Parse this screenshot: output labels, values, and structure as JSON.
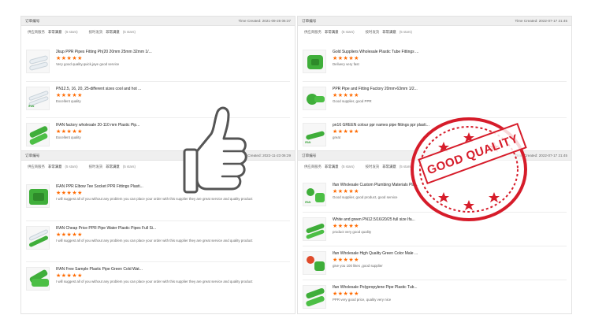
{
  "colors": {
    "star": "#ff6a00",
    "pipe_white": "#e9eef2",
    "pipe_green": "#3fae3a",
    "stamp": "#d61c2a"
  },
  "panels": [
    {
      "order_label": "订单编号",
      "time_created": "Time Created: 2021-09-28 06:37",
      "rating_label_1": "供应商服务",
      "rating_value_1": "非常满意",
      "rating_count_1": "(5 stars)",
      "rating_label_2": "按时发货",
      "rating_value_2": "非常满意",
      "rating_count_2": "(5 stars)",
      "items": [
        {
          "title": "2kup PPR Pipes Fitting Ph(20 20mm 25mm 32mm 1/...",
          "stars": "★★★★★",
          "comment": "Very good quality,quick,jaye good service",
          "thumb": "white-pipe"
        },
        {
          "title": "PN12.5, 16, 20, 25-different sizes cool and hot ...",
          "stars": "★★★★★",
          "comment": "Excellent quality",
          "thumb": "white-pipe"
        },
        {
          "title": "IFAN factory wholesale 20-110 mm Plastic Pip...",
          "stars": "★★★★★",
          "comment": "Excellent quality",
          "thumb": "green-pipe"
        }
      ]
    },
    {
      "order_label": "订单编号",
      "time_created": "Time Created: 2022-07-17 21:45",
      "rating_label_1": "供应商服务",
      "rating_value_1": "非常满意",
      "rating_count_1": "(5 stars)",
      "rating_label_2": "按时发货",
      "rating_value_2": "非常满意",
      "rating_count_2": "(5 stars)",
      "items": [
        {
          "title": "Gold Suppliers Wholesale Plastic Tube Fittings ...",
          "stars": "★★★★★",
          "comment": "Delivery very fast",
          "thumb": "green-fittings"
        },
        {
          "title": "PPR Pipe and Fitting Factory 20mm-63mm 1/2...",
          "stars": "★★★★★",
          "comment": "Good supplier, good PPR",
          "thumb": "green-fittings"
        },
        {
          "title": "pn16 GREEN colour ppr names pipe fittings ppr plasti...",
          "stars": "★★★★★",
          "comment": "great",
          "thumb": "green-pipe"
        }
      ]
    },
    {
      "order_label": "订单编号",
      "time_created": "Time Created: 2022-11-23 06:29",
      "rating_label_1": "供应商服务",
      "rating_value_1": "非常满意",
      "rating_count_1": "(5 stars)",
      "rating_label_2": "按时发货",
      "rating_value_2": "非常满意",
      "rating_count_2": "(5 stars)",
      "items": [
        {
          "title": "IFAN PPR Elbow Tee Socket PPR Fittings Plasti...",
          "stars": "★★★★★",
          "comment": "I will suggest all of you without any problem you can place your order with this supplier they are great service and quality product",
          "thumb": "green-fittings"
        },
        {
          "title": "IFAN Cheap Price PPR Pipe Water Plastic Pipes Full Si...",
          "stars": "★★★★★",
          "comment": "I will suggest all of you without any problem you can place your order with this supplier they are great service and quality product",
          "thumb": "white-pipe"
        },
        {
          "title": "IFAN Free Sample Plastic Pipe Green Cold Wat...",
          "stars": "★★★★★",
          "comment": "I will suggest all of you without any problem you can place your order with this supplier they are great service and quality product",
          "thumb": "green-pipe"
        }
      ]
    },
    {
      "order_label": "订单编号",
      "time_created": "Time Created: 2022-07-17 21:45",
      "rating_label_1": "供应商服务",
      "rating_value_1": "非常满意",
      "rating_count_1": "(5 stars)",
      "rating_label_2": "按时发货",
      "rating_value_2": "非常满意",
      "rating_count_2": "(5 stars)",
      "items": [
        {
          "title": "Ifan Wholesale Custom Plumbing Materials Pla...",
          "stars": "★★★★★",
          "comment": "Good supplier, good product, good service",
          "thumb": "green-fittings"
        },
        {
          "title": "White and green PN12.5/16/20/25 full size Ifa...",
          "stars": "★★★★★",
          "comment": "product very good quality",
          "thumb": "green-pipe"
        },
        {
          "title": "Ifan Wholesale High Quality Green Color Male ...",
          "stars": "★★★★★",
          "comment": "give you 100 likes ,good supplier",
          "thumb": "green-fittings"
        },
        {
          "title": "Ifan Wholesale Polypropylene Pipe Plastic Tub...",
          "stars": "★★★★★",
          "comment": "PPR very good price, quality very nice",
          "thumb": "green-pipe"
        }
      ]
    }
  ],
  "stamp": {
    "text": "GOOD QUALITY"
  }
}
